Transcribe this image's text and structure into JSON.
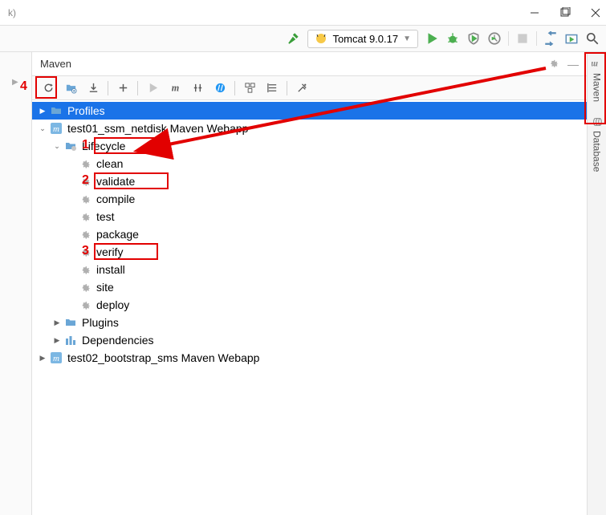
{
  "window": {
    "title_suffix": "k)"
  },
  "run_config": {
    "label": "Tomcat 9.0.17"
  },
  "maven_panel": {
    "title": "Maven",
    "tree": {
      "profiles": "Profiles",
      "project1": "test01_ssm_netdisk Maven Webapp",
      "lifecycle_label": "Lifecycle",
      "lifecycle": [
        "clean",
        "validate",
        "compile",
        "test",
        "package",
        "verify",
        "install",
        "site",
        "deploy"
      ],
      "plugins": "Plugins",
      "dependencies": "Dependencies",
      "project2": "test02_bootstrap_sms Maven Webapp"
    }
  },
  "sidebar": {
    "maven": "Maven",
    "database": "Database"
  },
  "annotations": {
    "l1": "1",
    "l2": "2",
    "l3": "3",
    "l4": "4"
  }
}
